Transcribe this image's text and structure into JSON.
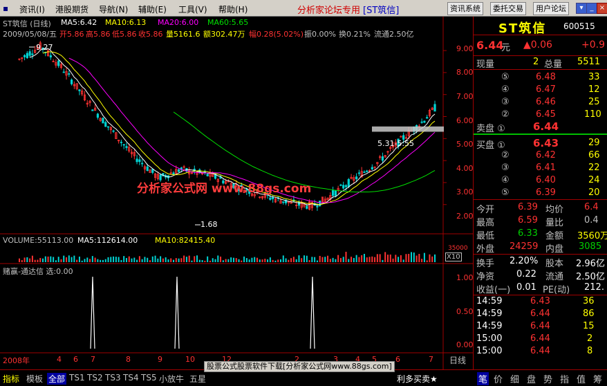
{
  "menu": {
    "items": [
      "资讯(I)",
      "港股期货",
      "导航(N)",
      "辅助(E)",
      "工具(V)",
      "帮助(H)"
    ],
    "title": "分析家论坛专用",
    "title_stock": "[ST筑信]",
    "buttons": [
      "资讯系统",
      "委托交易",
      "用户论坛"
    ],
    "window_controls": [
      "▾",
      "_",
      "□",
      "×"
    ]
  },
  "chart": {
    "title": "ST筑信 (日线)",
    "ma5": "MA5:6.42",
    "ma10": "MA10:6.13",
    "ma20": "MA20:6.00",
    "ma60": "MA60:5.65",
    "date_label": "2009/05/08/五",
    "open": "开5.86",
    "high": "高5.86",
    "low": "低5.86",
    "close": "收5.86",
    "volume": "量5161.6",
    "amount": "额302.47万",
    "change": "幅0.28(5.02%)",
    "amplitude": "振0.00%",
    "turnover": "换0.21%",
    "float": "流通2.50亿",
    "price_ticks": [
      "9.00",
      "8.00",
      "7.00",
      "6.00",
      "5.00",
      "4.00",
      "3.00",
      "2.00"
    ],
    "high_mark": "9.27",
    "low_mark": "1.68",
    "range_label": "5.31-5.55",
    "watermark": "分析家公式网 www.88gs.com",
    "volume_title": "VOLUME:55113.00",
    "vol_ma5": "MA5:112614.00",
    "vol_ma10": "MA10:82415.40",
    "vol_scale": "35000",
    "vol_unit": "X10",
    "indicator_title": "赌赢-通达信 选:0.00",
    "ind_ticks": [
      "1.00",
      "0.50",
      "0.00"
    ],
    "date_axis": [
      "2008年",
      "4",
      "6",
      "7",
      "8",
      "9",
      "10",
      "12",
      "2",
      "3",
      "4",
      "5",
      "6",
      "7"
    ],
    "daily_label": "日线"
  },
  "chart_data": {
    "type": "bar",
    "title": "ST筑信 (日线)",
    "ylim": [
      1.3,
      9.6
    ],
    "series": [
      {
        "name": "MA5",
        "value": 6.42
      },
      {
        "name": "MA10",
        "value": 6.13
      },
      {
        "name": "MA20",
        "value": 6.0
      },
      {
        "name": "MA60",
        "value": 5.65
      }
    ],
    "annotations": [
      "9.27",
      "1.68",
      "5.31-5.55"
    ]
  },
  "quote": {
    "name": "ST筑信",
    "code": "600515",
    "price": "6.44",
    "unit": "元",
    "change": "▲0.06",
    "pct": "+0.9",
    "now_vol_label": "现量",
    "now_vol": "2",
    "total_vol_label": "总量",
    "total_vol": "5511",
    "asks": [
      {
        "level": "⑤",
        "price": "6.48",
        "vol": "33"
      },
      {
        "level": "④",
        "price": "6.47",
        "vol": "12"
      },
      {
        "level": "③",
        "price": "6.46",
        "vol": "25"
      },
      {
        "level": "②",
        "price": "6.45",
        "vol": "110"
      }
    ],
    "ask1": {
      "label": "卖盘 ①",
      "price": "6.44"
    },
    "bid1": {
      "label": "买盘 ①",
      "price": "6.43",
      "vol": "29"
    },
    "bids": [
      {
        "level": "②",
        "price": "6.42",
        "vol": "66"
      },
      {
        "level": "③",
        "price": "6.41",
        "vol": "22"
      },
      {
        "level": "④",
        "price": "6.40",
        "vol": "24"
      },
      {
        "level": "⑤",
        "price": "6.39",
        "vol": "20"
      }
    ],
    "stats": [
      [
        "今开",
        "6.39",
        "均价",
        "6.4"
      ],
      [
        "最高",
        "6.59",
        "量比",
        "0.4"
      ],
      [
        "最低",
        "6.33",
        "金额",
        "3560万"
      ],
      [
        "外盘",
        "24259",
        "内盘",
        "3085"
      ]
    ],
    "fund": [
      [
        "换手",
        "2.20%",
        "股本",
        "2.96亿"
      ],
      [
        "净资",
        "0.22",
        "流通",
        "2.50亿"
      ],
      [
        "收益(一)",
        "0.01",
        "PE(动)",
        "212."
      ]
    ],
    "ticks": [
      {
        "time": "14:59",
        "price": "6.43",
        "vol": "36"
      },
      {
        "time": "14:59",
        "price": "6.44",
        "vol": "86"
      },
      {
        "time": "14:59",
        "price": "6.44",
        "vol": "15"
      },
      {
        "time": "15:00",
        "price": "6.44",
        "vol": "2"
      },
      {
        "time": "15:00",
        "price": "6.44",
        "vol": "8"
      }
    ]
  },
  "bottom": {
    "tabs": [
      "指标",
      "模板",
      "全部",
      "TS1",
      "TS2",
      "TS3",
      "TS4",
      "TS5",
      "小放牛",
      "五星"
    ],
    "promo": "股票公式股票软件下载[分析家公式网www.88gs.com]",
    "marquee": "利多买卖★",
    "right_tabs": [
      "笔",
      "价",
      "细",
      "盘",
      "势",
      "指",
      "值",
      "筹"
    ]
  },
  "colors": {
    "up": "#ff3232",
    "down": "#00d4d4",
    "ma5": "#ffffff",
    "ma10": "#ffff00",
    "ma20": "#ff00ff",
    "ma60": "#00e000",
    "axis": "#a00000"
  }
}
